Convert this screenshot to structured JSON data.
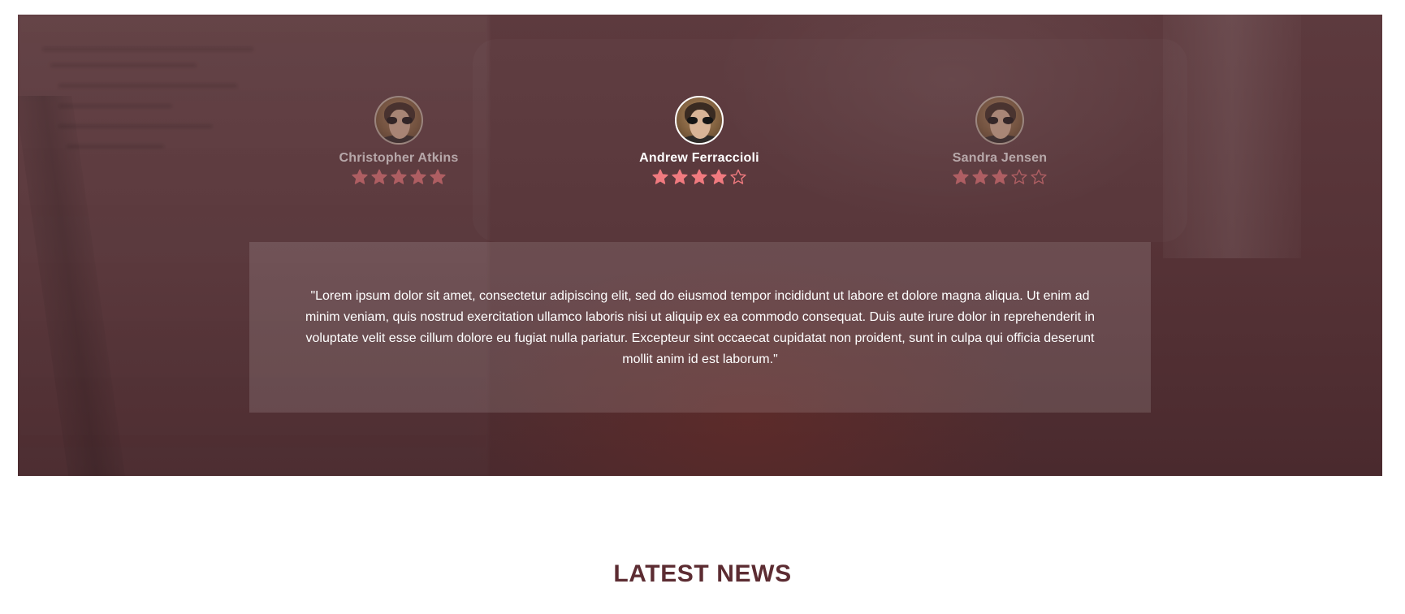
{
  "testimonials": {
    "reviewers": [
      {
        "name": "Christopher Atkins",
        "rating": 5,
        "max_rating": 5,
        "active": false
      },
      {
        "name": "Andrew Ferraccioli",
        "rating": 4,
        "max_rating": 5,
        "active": true
      },
      {
        "name": "Sandra Jensen",
        "rating": 3,
        "max_rating": 5,
        "active": false
      }
    ],
    "quote": "\"Lorem ipsum dolor sit amet, consectetur adipiscing elit, sed do eiusmod tempor incididunt ut labore et dolore magna aliqua. Ut enim ad minim veniam, quis nostrud exercitation ullamco laboris nisi ut aliquip ex ea commodo consequat. Duis aute irure dolor in reprehenderit in voluptate velit esse cillum dolore eu fugiat nulla pariatur. Excepteur sint occaecat cupidatat non proident, sunt in culpa qui officia deserunt mollit anim id est laborum.\""
  },
  "latest_news": {
    "title": "LATEST NEWS"
  },
  "colors": {
    "star": "#f07a7f",
    "overlay": "#5a363a",
    "heading": "#5c2c32"
  },
  "icons": {
    "star_filled": "star-filled-icon",
    "star_empty": "star-outline-icon"
  }
}
